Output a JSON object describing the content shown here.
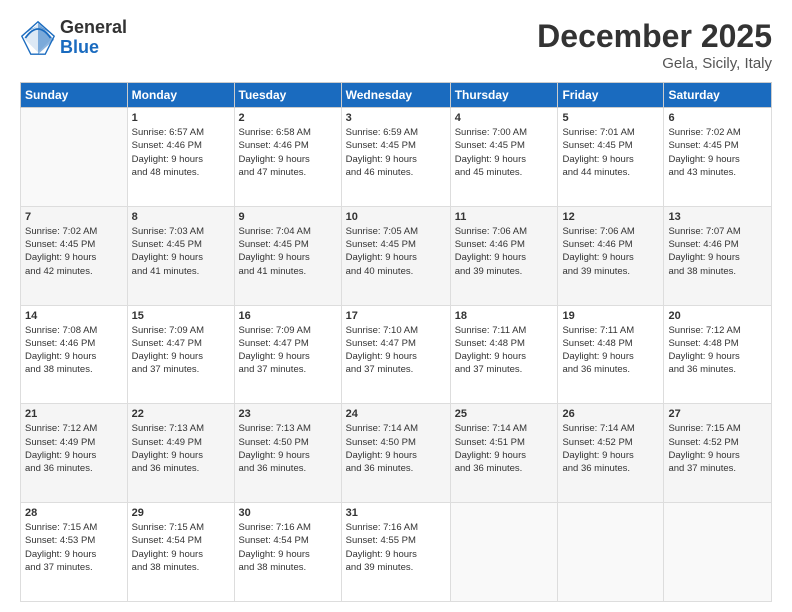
{
  "logo": {
    "general": "General",
    "blue": "Blue"
  },
  "title": "December 2025",
  "subtitle": "Gela, Sicily, Italy",
  "header_days": [
    "Sunday",
    "Monday",
    "Tuesday",
    "Wednesday",
    "Thursday",
    "Friday",
    "Saturday"
  ],
  "weeks": [
    [
      {
        "num": "",
        "info": ""
      },
      {
        "num": "1",
        "info": "Sunrise: 6:57 AM\nSunset: 4:46 PM\nDaylight: 9 hours\nand 48 minutes."
      },
      {
        "num": "2",
        "info": "Sunrise: 6:58 AM\nSunset: 4:46 PM\nDaylight: 9 hours\nand 47 minutes."
      },
      {
        "num": "3",
        "info": "Sunrise: 6:59 AM\nSunset: 4:45 PM\nDaylight: 9 hours\nand 46 minutes."
      },
      {
        "num": "4",
        "info": "Sunrise: 7:00 AM\nSunset: 4:45 PM\nDaylight: 9 hours\nand 45 minutes."
      },
      {
        "num": "5",
        "info": "Sunrise: 7:01 AM\nSunset: 4:45 PM\nDaylight: 9 hours\nand 44 minutes."
      },
      {
        "num": "6",
        "info": "Sunrise: 7:02 AM\nSunset: 4:45 PM\nDaylight: 9 hours\nand 43 minutes."
      }
    ],
    [
      {
        "num": "7",
        "info": "Sunrise: 7:02 AM\nSunset: 4:45 PM\nDaylight: 9 hours\nand 42 minutes."
      },
      {
        "num": "8",
        "info": "Sunrise: 7:03 AM\nSunset: 4:45 PM\nDaylight: 9 hours\nand 41 minutes."
      },
      {
        "num": "9",
        "info": "Sunrise: 7:04 AM\nSunset: 4:45 PM\nDaylight: 9 hours\nand 41 minutes."
      },
      {
        "num": "10",
        "info": "Sunrise: 7:05 AM\nSunset: 4:45 PM\nDaylight: 9 hours\nand 40 minutes."
      },
      {
        "num": "11",
        "info": "Sunrise: 7:06 AM\nSunset: 4:46 PM\nDaylight: 9 hours\nand 39 minutes."
      },
      {
        "num": "12",
        "info": "Sunrise: 7:06 AM\nSunset: 4:46 PM\nDaylight: 9 hours\nand 39 minutes."
      },
      {
        "num": "13",
        "info": "Sunrise: 7:07 AM\nSunset: 4:46 PM\nDaylight: 9 hours\nand 38 minutes."
      }
    ],
    [
      {
        "num": "14",
        "info": "Sunrise: 7:08 AM\nSunset: 4:46 PM\nDaylight: 9 hours\nand 38 minutes."
      },
      {
        "num": "15",
        "info": "Sunrise: 7:09 AM\nSunset: 4:47 PM\nDaylight: 9 hours\nand 37 minutes."
      },
      {
        "num": "16",
        "info": "Sunrise: 7:09 AM\nSunset: 4:47 PM\nDaylight: 9 hours\nand 37 minutes."
      },
      {
        "num": "17",
        "info": "Sunrise: 7:10 AM\nSunset: 4:47 PM\nDaylight: 9 hours\nand 37 minutes."
      },
      {
        "num": "18",
        "info": "Sunrise: 7:11 AM\nSunset: 4:48 PM\nDaylight: 9 hours\nand 37 minutes."
      },
      {
        "num": "19",
        "info": "Sunrise: 7:11 AM\nSunset: 4:48 PM\nDaylight: 9 hours\nand 36 minutes."
      },
      {
        "num": "20",
        "info": "Sunrise: 7:12 AM\nSunset: 4:48 PM\nDaylight: 9 hours\nand 36 minutes."
      }
    ],
    [
      {
        "num": "21",
        "info": "Sunrise: 7:12 AM\nSunset: 4:49 PM\nDaylight: 9 hours\nand 36 minutes."
      },
      {
        "num": "22",
        "info": "Sunrise: 7:13 AM\nSunset: 4:49 PM\nDaylight: 9 hours\nand 36 minutes."
      },
      {
        "num": "23",
        "info": "Sunrise: 7:13 AM\nSunset: 4:50 PM\nDaylight: 9 hours\nand 36 minutes."
      },
      {
        "num": "24",
        "info": "Sunrise: 7:14 AM\nSunset: 4:50 PM\nDaylight: 9 hours\nand 36 minutes."
      },
      {
        "num": "25",
        "info": "Sunrise: 7:14 AM\nSunset: 4:51 PM\nDaylight: 9 hours\nand 36 minutes."
      },
      {
        "num": "26",
        "info": "Sunrise: 7:14 AM\nSunset: 4:52 PM\nDaylight: 9 hours\nand 36 minutes."
      },
      {
        "num": "27",
        "info": "Sunrise: 7:15 AM\nSunset: 4:52 PM\nDaylight: 9 hours\nand 37 minutes."
      }
    ],
    [
      {
        "num": "28",
        "info": "Sunrise: 7:15 AM\nSunset: 4:53 PM\nDaylight: 9 hours\nand 37 minutes."
      },
      {
        "num": "29",
        "info": "Sunrise: 7:15 AM\nSunset: 4:54 PM\nDaylight: 9 hours\nand 38 minutes."
      },
      {
        "num": "30",
        "info": "Sunrise: 7:16 AM\nSunset: 4:54 PM\nDaylight: 9 hours\nand 38 minutes."
      },
      {
        "num": "31",
        "info": "Sunrise: 7:16 AM\nSunset: 4:55 PM\nDaylight: 9 hours\nand 39 minutes."
      },
      {
        "num": "",
        "info": ""
      },
      {
        "num": "",
        "info": ""
      },
      {
        "num": "",
        "info": ""
      }
    ]
  ]
}
